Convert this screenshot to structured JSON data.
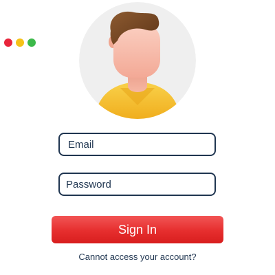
{
  "window_controls": {
    "colors": [
      "#e8253b",
      "#f5c218",
      "#3cb94a"
    ]
  },
  "avatar": {
    "icon": "user-avatar-icon",
    "colors": {
      "background": "#efefef",
      "hair": "#7a4a26",
      "skin": "#f6b7a4",
      "shirt": "#f7c531"
    }
  },
  "login_form": {
    "email_placeholder": "Email",
    "password_placeholder": "Password",
    "sign_in_label": "Sign In",
    "forgot_link": "Cannot access your account?"
  },
  "colors": {
    "accent": "#e62e2e",
    "text": "#1f3550"
  }
}
